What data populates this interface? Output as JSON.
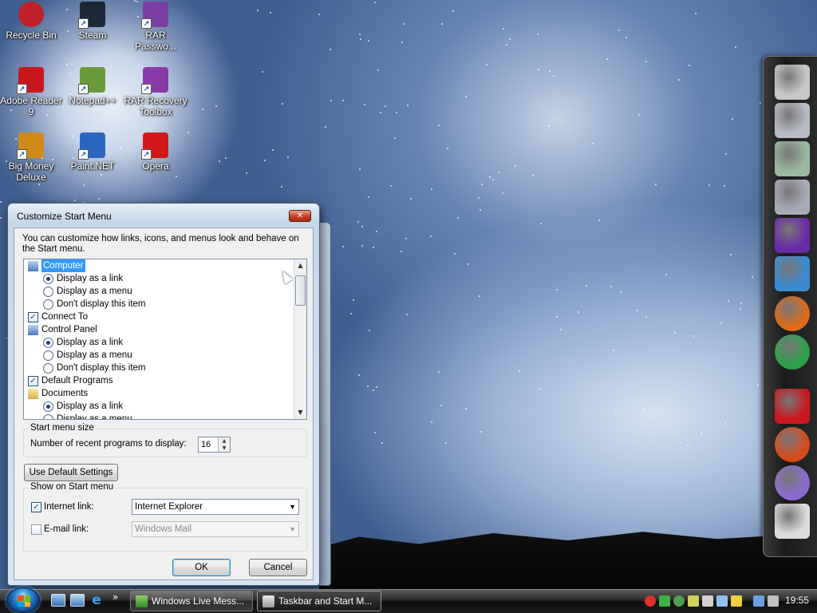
{
  "desktop": {
    "icons": [
      {
        "label": "Recycle Bin",
        "icon": "recycle-bin-icon",
        "color": "#c0202a"
      },
      {
        "label": "Steam",
        "icon": "steam-icon",
        "color": "#1b2838"
      },
      {
        "label": "RAR Passwo...",
        "icon": "rar-password-icon",
        "color": "#7a3fa0"
      },
      {
        "label": "Adobe Reader 9",
        "icon": "adobe-reader-icon",
        "color": "#c8181e"
      },
      {
        "label": "Notepad++",
        "icon": "notepad-plus-plus-icon",
        "color": "#6a9b3a"
      },
      {
        "label": "RAR Recovery Toolbox",
        "icon": "rar-recovery-icon",
        "color": "#8a3aa8"
      },
      {
        "label": "Big Money Deluxe",
        "icon": "big-money-icon",
        "color": "#d08a1a"
      },
      {
        "label": "Paint.NET",
        "icon": "paint-net-icon",
        "color": "#2a66c0"
      },
      {
        "label": "Opera",
        "icon": "opera-icon",
        "color": "#d01818"
      }
    ]
  },
  "dock": {
    "items": [
      {
        "icon": "computer-icon",
        "color": "#c8c8c8"
      },
      {
        "icon": "documents-folder-icon",
        "color": "#b8bcc4"
      },
      {
        "icon": "green-folder-icon",
        "color": "#9ab8a0"
      },
      {
        "icon": "pictures-folder-icon",
        "color": "#a8acb8"
      },
      {
        "icon": "cpu-chip-icon",
        "color": "#6a2aa8"
      },
      {
        "icon": "messenger-icon",
        "color": "#3a8ad0"
      },
      {
        "icon": "firefox-icon",
        "color": "#e06a18"
      },
      {
        "icon": "chrome-icon",
        "color": "#2aa048"
      },
      {
        "icon": "adobe-reader-icon",
        "color": "#c8181e"
      },
      {
        "icon": "p-logo-icon",
        "color": "#d84a1a"
      },
      {
        "icon": "paint-brush-icon",
        "color": "#8a6ad0"
      },
      {
        "icon": "recycle-bin-icon",
        "color": "#dcdcdc"
      }
    ]
  },
  "dialog": {
    "title": "Customize Start Menu",
    "close_label": "✕",
    "intro": "You can customize how links, icons, and menus look and behave on the Start menu.",
    "list_items": [
      {
        "type": "header",
        "label": "Computer",
        "selected": true,
        "icon": "computer-icon"
      },
      {
        "type": "radio",
        "label": "Display as a link",
        "checked": true
      },
      {
        "type": "radio",
        "label": "Display as a menu",
        "checked": false
      },
      {
        "type": "radio",
        "label": "Don't display this item",
        "checked": false
      },
      {
        "type": "check",
        "label": "Connect To",
        "checked": true
      },
      {
        "type": "header",
        "label": "Control Panel",
        "selected": false,
        "icon": "control-panel-icon"
      },
      {
        "type": "radio",
        "label": "Display as a link",
        "checked": true
      },
      {
        "type": "radio",
        "label": "Display as a menu",
        "checked": false
      },
      {
        "type": "radio",
        "label": "Don't display this item",
        "checked": false
      },
      {
        "type": "check",
        "label": "Default Programs",
        "checked": true
      },
      {
        "type": "header",
        "label": "Documents",
        "selected": false,
        "icon": "documents-folder-icon"
      },
      {
        "type": "radio",
        "label": "Display as a link",
        "checked": true
      },
      {
        "type": "radio",
        "label": "Display as a menu",
        "checked": false
      }
    ],
    "size_group": {
      "title": "Start menu size",
      "recent_label": "Number of recent programs to display:",
      "recent_value": "16"
    },
    "default_button": "Use Default Settings",
    "show_group": {
      "title": "Show on Start menu",
      "internet_label": "Internet link:",
      "internet_checked": true,
      "internet_value": "Internet Explorer",
      "email_label": "E-mail link:",
      "email_checked": false,
      "email_value": "Windows Mail"
    },
    "ok": "OK",
    "cancel": "Cancel"
  },
  "taskbar": {
    "quick_launch": [
      "show-desktop-icon",
      "switch-windows-icon",
      "internet-explorer-icon"
    ],
    "overflow": "»",
    "tasks": [
      {
        "label": "Windows Live Mess...",
        "icon": "messenger-icon",
        "active": false
      },
      {
        "label": "Taskbar and Start M...",
        "icon": "taskbar-properties-icon",
        "active": true
      }
    ],
    "clock": "19:55"
  }
}
